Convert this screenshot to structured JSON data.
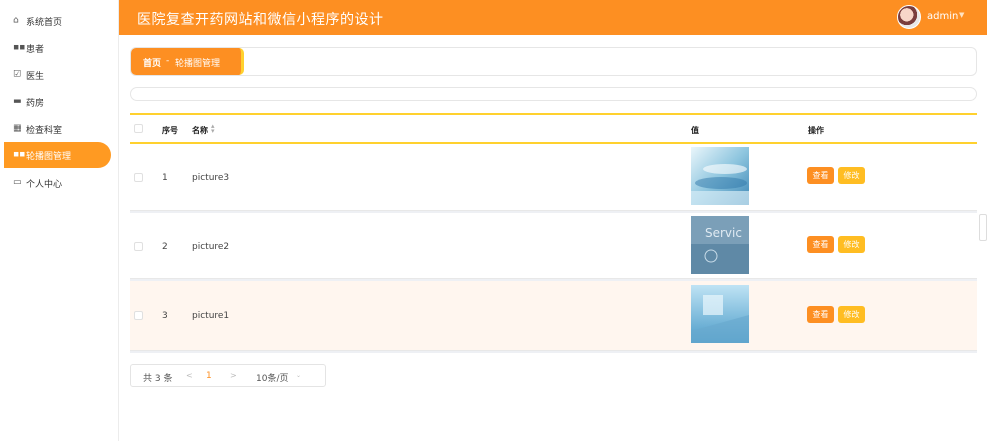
{
  "app": {
    "title": "医院复查开药网站和微信小程序的设计"
  },
  "user": {
    "name": "admin",
    "caret": "▼"
  },
  "sidebar": {
    "items": [
      {
        "label": "系统首页",
        "icon": "home-icon"
      },
      {
        "label": "患者",
        "icon": "grid-icon"
      },
      {
        "label": "医生",
        "icon": "check-square-icon"
      },
      {
        "label": "药房",
        "icon": "bed-icon"
      },
      {
        "label": "检查科室",
        "icon": "grid-icon"
      },
      {
        "label": "轮播图管理",
        "icon": "grid-icon",
        "active": true
      },
      {
        "label": "个人中心",
        "icon": "card-icon"
      }
    ]
  },
  "breadcrumb": {
    "home": "首页",
    "sep": "-",
    "current": "轮播图管理"
  },
  "table": {
    "headers": {
      "index": "序号",
      "name": "名称",
      "value": "值",
      "actions": "操作"
    },
    "rows": [
      {
        "index": "1",
        "name": "picture3",
        "view": "查看",
        "edit": "修改"
      },
      {
        "index": "2",
        "name": "picture2",
        "view": "查看",
        "edit": "修改",
        "thumb_text": "Servic"
      },
      {
        "index": "3",
        "name": "picture1",
        "view": "查看",
        "edit": "修改"
      }
    ]
  },
  "pagination": {
    "total": "共 3 条",
    "prev": "<",
    "current_page": "1",
    "next": ">",
    "page_size": "10条/页",
    "caret": "⌄"
  },
  "colors": {
    "primary": "#fd8f22",
    "accent": "#ffd12e",
    "edit": "#ffbd22",
    "row_highlight": "#fff6ef"
  }
}
